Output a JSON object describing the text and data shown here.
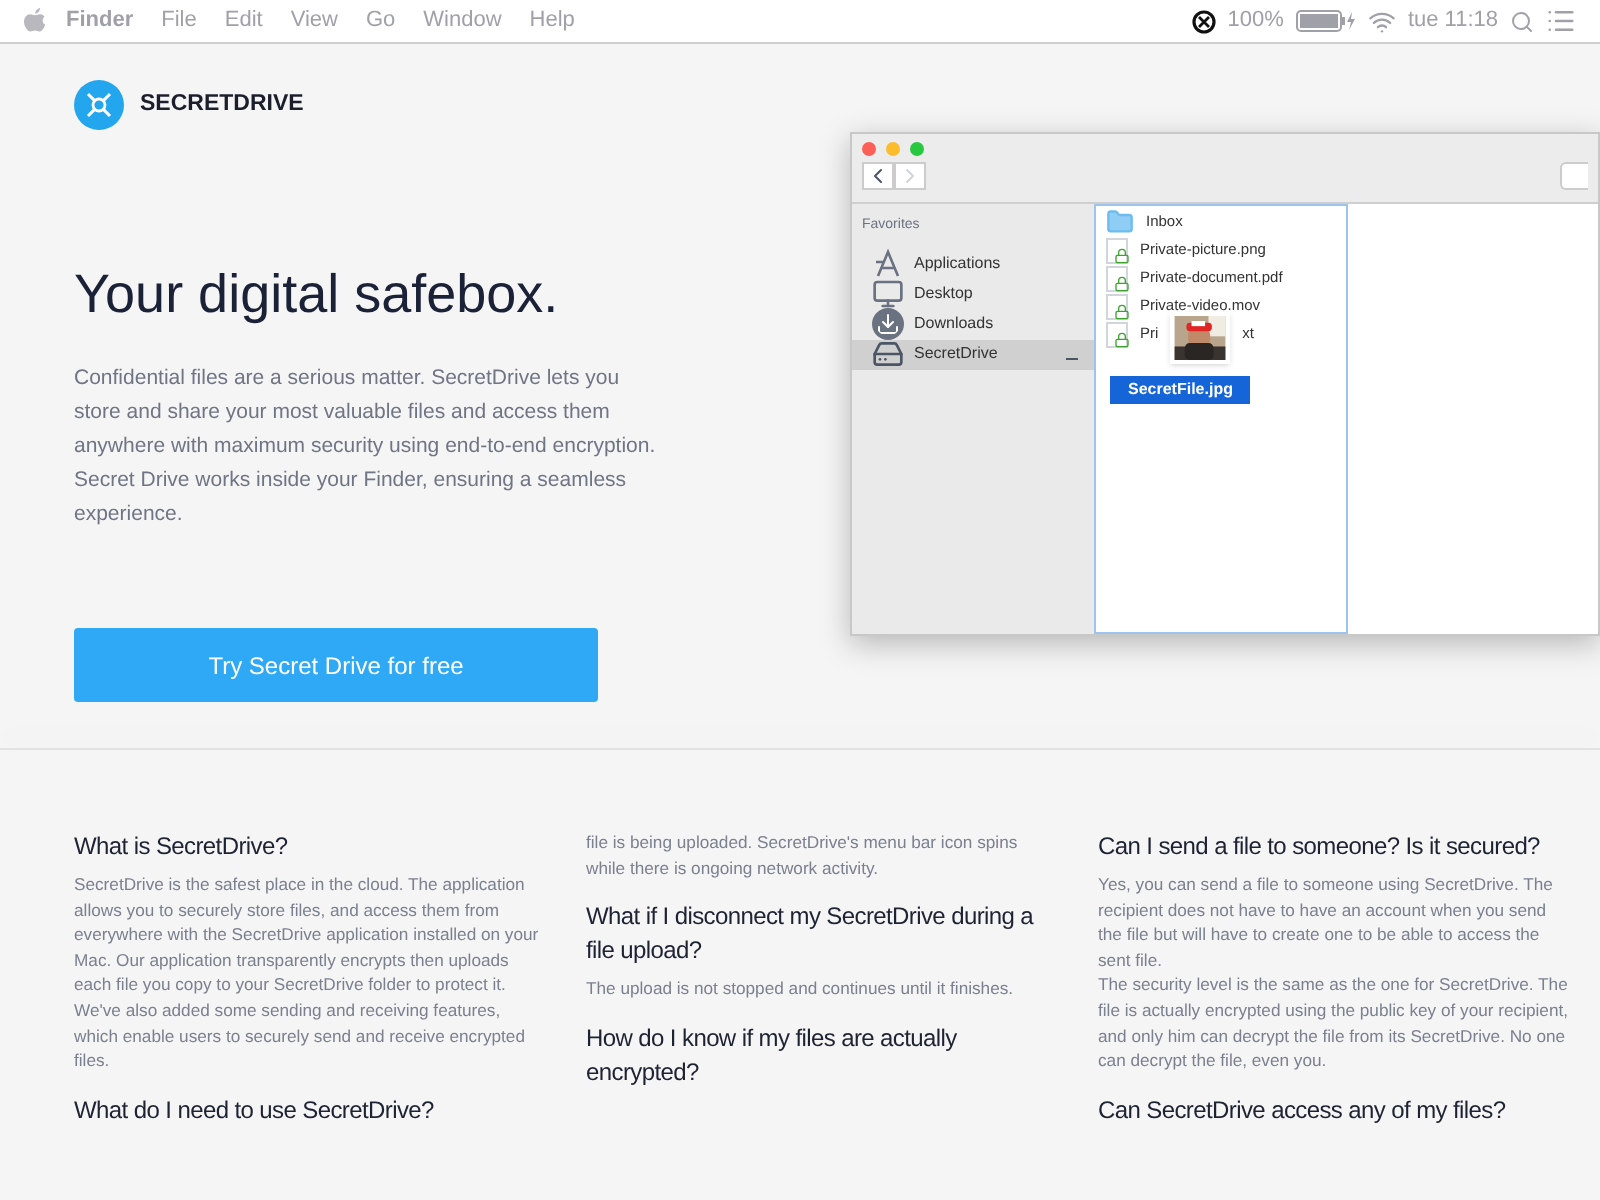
{
  "menu_bar": {
    "app": "Finder",
    "menus": [
      "File",
      "Edit",
      "View",
      "Go",
      "Window",
      "Help"
    ],
    "battery": "100%",
    "clock": "tue 11:18"
  },
  "brand": {
    "name": "SECRETDRIVE"
  },
  "hero": {
    "title": "Your digital safebox.",
    "text": "Confidential files are a serious matter. SecretDrive lets you store and share your most valuable files and access them anywhere with maximum security using end-to-end encryption. Secret Drive works inside your Finder, ensuring a seamless experience.",
    "cta": "Try Secret Drive for free"
  },
  "finder": {
    "sidebar_heading": "Favorites",
    "sidebar_items": [
      {
        "label": "Applications",
        "kind": "apps",
        "selected": false
      },
      {
        "label": "Desktop",
        "kind": "desktop",
        "selected": false
      },
      {
        "label": "Downloads",
        "kind": "downloads",
        "selected": false
      },
      {
        "label": "SecretDrive",
        "kind": "drive",
        "selected": true
      }
    ],
    "files": [
      {
        "label": "Inbox",
        "kind": "folder"
      },
      {
        "label": "Private-picture.png",
        "kind": "locked"
      },
      {
        "label": "Private-document.pdf",
        "kind": "locked"
      },
      {
        "label": "Private-video.mov",
        "kind": "locked"
      },
      {
        "label": "Pri",
        "label_end": "xt",
        "kind": "locked"
      }
    ],
    "dragged_file": "SecretFile.jpg"
  },
  "faq_columns": [
    [
      {
        "question": "What is SecretDrive?",
        "answer": "SecretDrive is the safest place in the cloud. The application allows you to securely store files, and access them from everywhere with the SecretDrive application installed on your Mac. Our application transparently encrypts then uploads each file you copy to your SecretDrive folder to protect it. We've also added some sending and receiving features, which enable users to securely send and receive encrypted files."
      },
      {
        "question": "What do I need to use SecretDrive?"
      }
    ],
    [
      {
        "answer": "file is being uploaded. SecretDrive's menu bar icon spins while there is ongoing network activity."
      },
      {
        "question": "What if I disconnect my SecretDrive during a file upload?",
        "answer": "The upload is not stopped and continues until it finishes."
      },
      {
        "question": "How do I know if my files are actually encrypted?"
      }
    ],
    [
      {
        "question": "Can I send a file to someone? Is it secured?",
        "answer": "Yes, you can send a file to someone using SecretDrive. The recipient does not have to have an account when you send the file but will have to create one to be able to access the sent file.\nThe security level is the same as the one for SecretDrive. The file is actually encrypted using the public key of your recipient, and only him can decrypt the file from its SecretDrive. No one can decrypt the file, even you."
      },
      {
        "question": "Can SecretDrive access any of my files?"
      }
    ]
  ]
}
